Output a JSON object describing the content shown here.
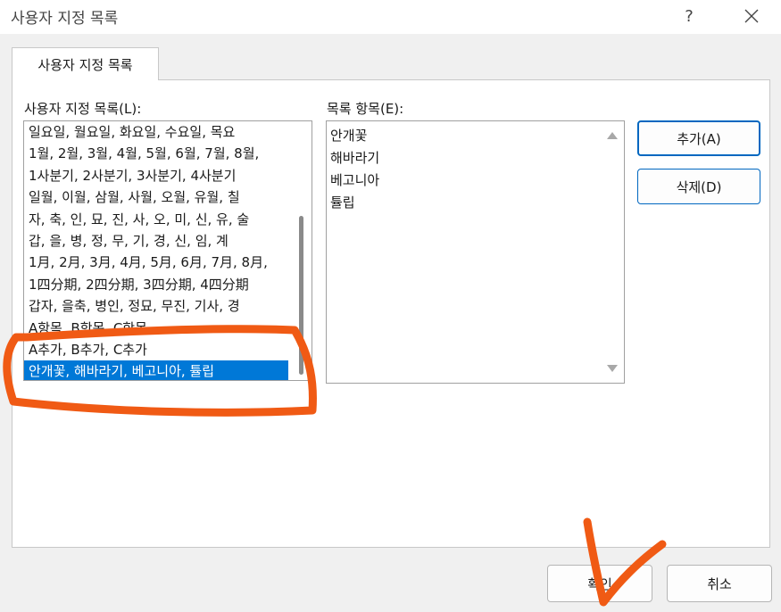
{
  "window": {
    "title": "사용자 지정 목록",
    "help_glyph": "?"
  },
  "tab": {
    "label": "사용자 지정 목록"
  },
  "custom_lists": {
    "label": "사용자 지정 목록(L):",
    "items": [
      "일요일, 월요일, 화요일, 수요일, 목요",
      "1월, 2월, 3월, 4월, 5월, 6월, 7월, 8월,",
      "1사분기, 2사분기, 3사분기, 4사분기",
      "일월, 이월, 삼월, 사월, 오월, 유월, 칠",
      "자, 축, 인, 묘, 진, 사, 오, 미, 신, 유, 술",
      "갑, 을, 병, 정, 무, 기, 경, 신, 임, 계",
      "1月, 2月, 3月, 4月, 5月, 6月, 7月, 8月,",
      "1四分期, 2四分期, 3四分期, 4四分期",
      "갑자, 을축, 병인, 정묘, 무진, 기사, 경",
      "A항목, B항목, C항목",
      "A추가, B추가, C추가",
      "안개꽃, 해바라기, 베고니아, 튤립"
    ],
    "selected_index": 11
  },
  "list_entries": {
    "label": "목록 항목(E):",
    "items": [
      "안개꽃",
      "해바라기",
      "베고니아",
      "튤립"
    ]
  },
  "buttons": {
    "add": "추가(A)",
    "delete": "삭제(D)",
    "ok": "확인",
    "cancel": "취소"
  },
  "colors": {
    "selection": "#0078d7",
    "annotation": "#f05a14"
  }
}
